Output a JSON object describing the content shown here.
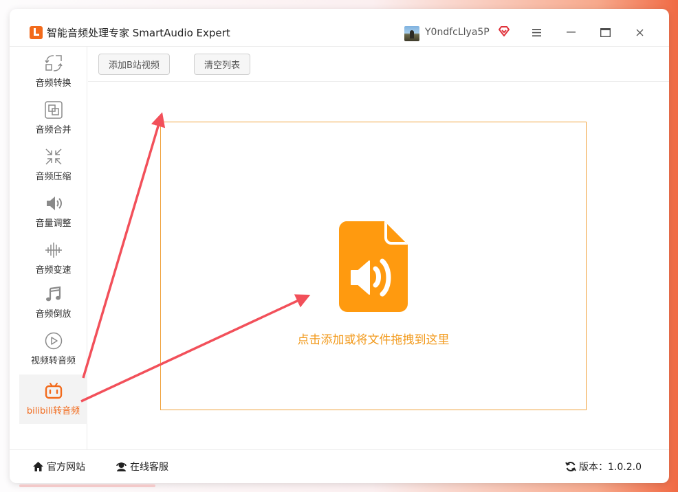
{
  "app": {
    "title": "智能音频处理专家 SmartAudio Expert",
    "username": "Y0ndfcLlya5P",
    "accent_color": "#f26a1b"
  },
  "window_controls": {
    "menu_icon": "hamburger-icon",
    "minimize_icon": "minimize-icon",
    "maximize_icon": "maximize-icon",
    "close_icon": "close-icon"
  },
  "sidebar": {
    "items": [
      {
        "label": "音频转换",
        "icon": "convert-icon"
      },
      {
        "label": "音频合并",
        "icon": "merge-icon"
      },
      {
        "label": "音频压缩",
        "icon": "compress-icon"
      },
      {
        "label": "音量调整",
        "icon": "volume-icon"
      },
      {
        "label": "音频变速",
        "icon": "speed-icon"
      },
      {
        "label": "音频倒放",
        "icon": "music-note-icon"
      },
      {
        "label": "视频转音频",
        "icon": "play-icon"
      },
      {
        "label": "bilibili转音频",
        "icon": "bilibili-tv-icon",
        "active": true
      }
    ]
  },
  "toolbar": {
    "add_label": "添加B站视频",
    "clear_label": "清空列表"
  },
  "dropzone": {
    "text": "点击添加或将文件拖拽到这里",
    "icon": "audio-file-icon",
    "border_color": "#f0a23c"
  },
  "footer": {
    "website_label": "官方网站",
    "support_label": "在线客服",
    "version_label": "版本：1.0.2.0"
  },
  "annotation": {
    "arrow_color": "#f2505a"
  }
}
